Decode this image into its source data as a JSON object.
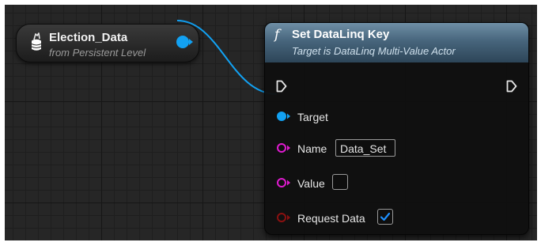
{
  "variable_node": {
    "title": "Election_Data",
    "subtitle": "from Persistent Level",
    "icon": "variable-stack-icon",
    "pin_color": "#12a1f2"
  },
  "function_node": {
    "glyph": "f",
    "title": "Set DataLinq Key",
    "subtitle": "Target is DataLinq Multi-Value Actor",
    "header_color": "#47657c",
    "pins": {
      "target": {
        "label": "Target",
        "color": "#12a1f2"
      },
      "name": {
        "label": "Name",
        "value": "Data_Set",
        "color": "#e01bd0"
      },
      "value": {
        "label": "Value",
        "checked": false,
        "color": "#e01bd0"
      },
      "request_data": {
        "label": "Request Data",
        "checked": true,
        "color": "#8a1010"
      }
    }
  }
}
